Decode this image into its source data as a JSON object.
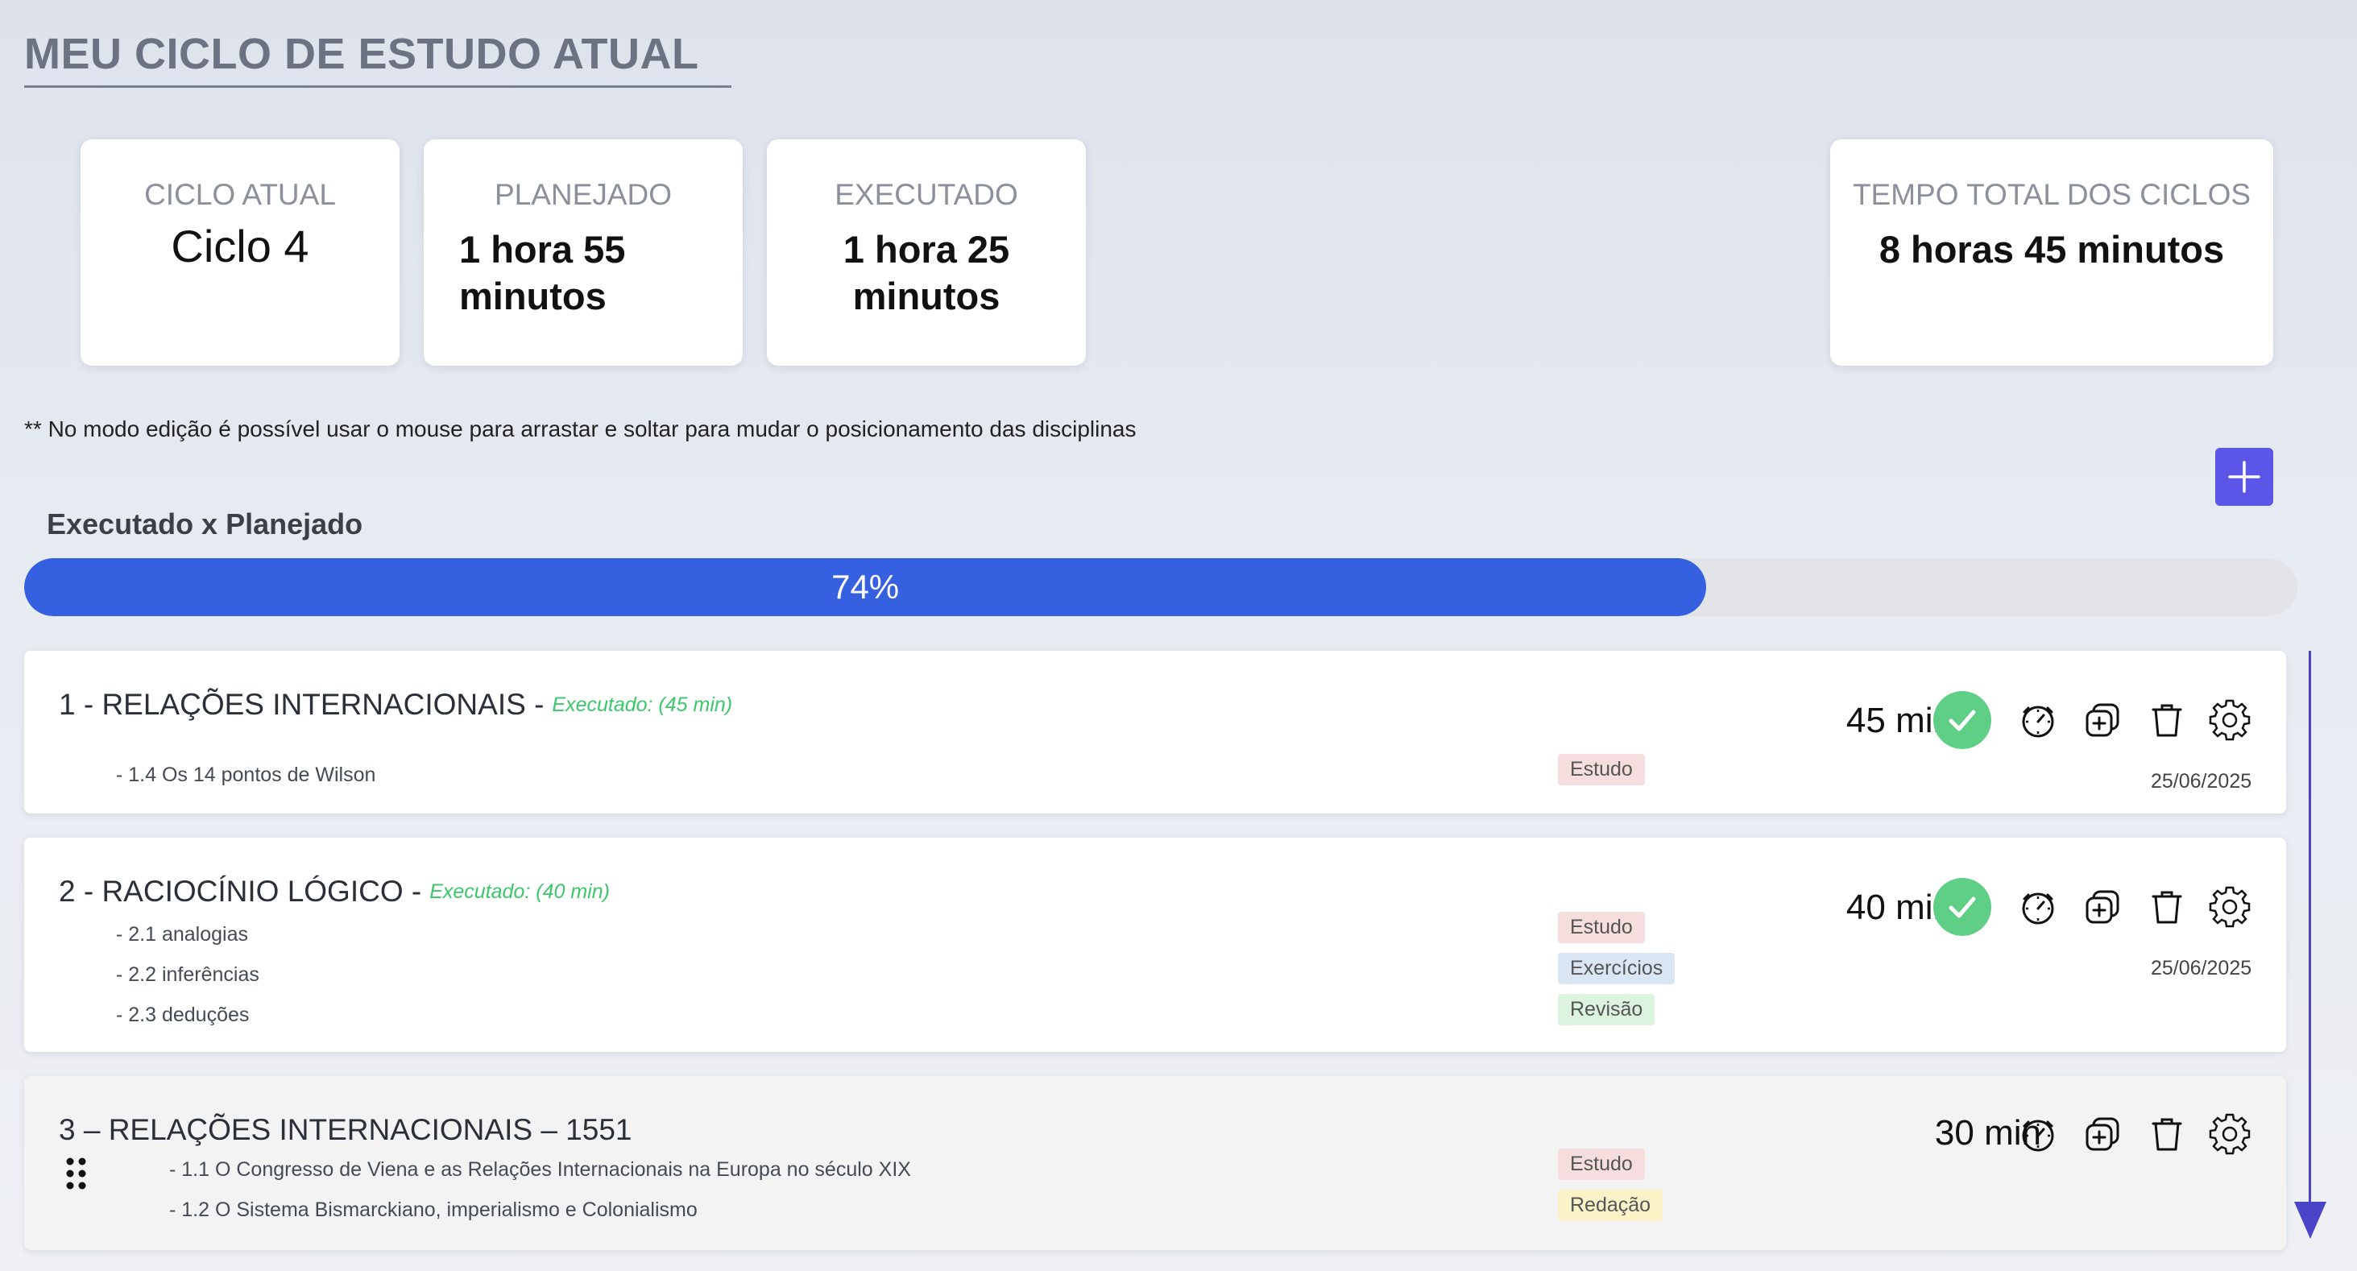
{
  "header": {
    "title": "MEU CICLO DE ESTUDO ATUAL"
  },
  "stats": {
    "ciclo_atual": {
      "label": "CICLO ATUAL",
      "value": "Ciclo 4"
    },
    "planejado": {
      "label": "PLANEJADO",
      "value": "1 hora 55 minutos"
    },
    "executado": {
      "label": "EXECUTADO",
      "value": "1 hora 25 minutos"
    },
    "tempo_total": {
      "label": "TEMPO TOTAL DOS CICLOS",
      "value": "8 horas 45 minutos"
    }
  },
  "note": "** No modo edição é possível usar o mouse para arrastar e soltar para mudar o posicionamento das disciplinas",
  "add_button_icon": "plus-icon",
  "progress": {
    "title": "Executado x Planejado",
    "percent": 74,
    "label": "74%"
  },
  "subjects": [
    {
      "title": "1 - RELAÇÕES INTERNACIONAIS -",
      "executed_note": "Executado: (45 min)",
      "topics": [
        "- 1.4 Os 14 pontos de Wilson"
      ],
      "badges": [
        "Estudo"
      ],
      "duration": "45 min",
      "completed": true,
      "date": "25/06/2025"
    },
    {
      "title": "2 - RACIOCÍNIO LÓGICO -",
      "executed_note": "Executado: (40 min)",
      "topics": [
        "- 2.1 analogias",
        "- 2.2 inferências",
        "- 2.3 deduções"
      ],
      "badges": [
        "Estudo",
        "Exercícios",
        "Revisão"
      ],
      "duration": "40 min",
      "completed": true,
      "date": "25/06/2025"
    },
    {
      "title": "3 – RELAÇÕES INTERNACIONAIS – 1551",
      "topics": [
        "- 1.1 O Congresso de Viena e as Relações Internacionais na Europa no século XIX",
        "- 1.2 O Sistema Bismarckiano, imperialismo e Colonialismo"
      ],
      "badges": [
        "Estudo",
        "Redação"
      ],
      "duration": "30 min",
      "completed": false
    }
  ],
  "colors": {
    "progress_fill": "#3560e0",
    "add_button": "#5b56e8",
    "check": "#5fcf85",
    "executed_note": "#3bc86a",
    "scroll_indicator": "#4b44c9"
  },
  "icons": [
    "plus-icon",
    "check-icon",
    "timer-icon",
    "duplicate-icon",
    "trash-icon",
    "gear-icon",
    "drag-handle-icon",
    "arrow-down-icon"
  ]
}
